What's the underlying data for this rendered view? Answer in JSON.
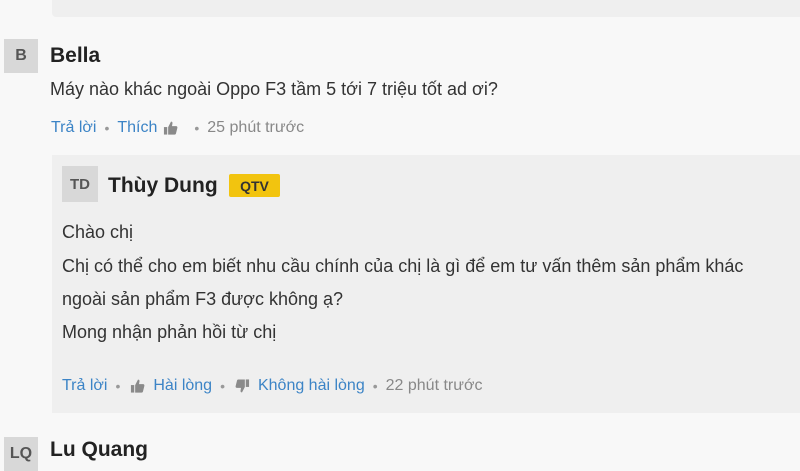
{
  "comments": [
    {
      "avatar": "B",
      "author": "Bella",
      "text": "Máy nào khác ngoài Oppo F3 tầm 5 tới 7 triệu tốt ad ơi?",
      "actions": {
        "reply": "Trả lời",
        "like": "Thích",
        "time": "25 phút trước"
      }
    },
    {
      "avatar": "LQ",
      "author": "Lu Quang"
    }
  ],
  "reply": {
    "avatar": "TD",
    "author": "Thùy Dung",
    "badge": "QTV",
    "lines": [
      "Chào chị",
      "Chị có thể cho em biết nhu cầu chính của chị là gì để em tư vấn thêm sản phẩm khác",
      "ngoài sản phẩm F3 được không ạ?",
      "Mong nhận phản hồi từ chị"
    ],
    "actions": {
      "reply": "Trả lời",
      "satisfied": "Hài lòng",
      "unsatisfied": "Không hài lòng",
      "time": "22 phút trước"
    }
  },
  "icons": {
    "like": "thumbs-up-icon",
    "dislike": "thumbs-down-icon"
  },
  "colors": {
    "link": "#3c84c6",
    "badge": "#f2c40f",
    "reply_bg": "#efefef",
    "avatar_bg": "#d8d8d8"
  }
}
